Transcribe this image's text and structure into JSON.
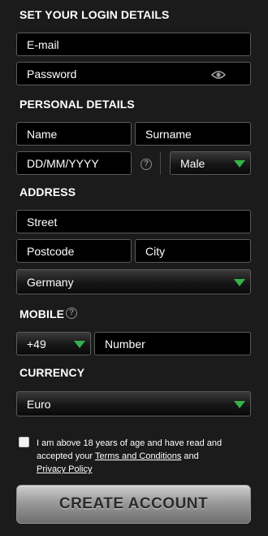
{
  "login": {
    "title": "SET YOUR LOGIN DETAILS",
    "email_placeholder": "E-mail",
    "password_placeholder": "Password"
  },
  "personal": {
    "title": "PERSONAL DETAILS",
    "name_placeholder": "Name",
    "surname_placeholder": "Surname",
    "dob_placeholder": "DD/MM/YYYY",
    "gender_value": "Male"
  },
  "address": {
    "title": "ADDRESS",
    "street_placeholder": "Street",
    "postcode_placeholder": "Postcode",
    "city_placeholder": "City",
    "country_value": "Germany"
  },
  "mobile": {
    "title": "MOBILE",
    "prefix_value": "+49",
    "number_placeholder": "Number"
  },
  "currency": {
    "title": "CURRENCY",
    "value": "Euro"
  },
  "terms": {
    "text_before": "I am above 18 years of age and have read and accepted your ",
    "terms_link": "Terms and Conditions",
    "text_middle": " and ",
    "privacy_link": "Privacy Policy"
  },
  "cta": {
    "label": "CREATE ACCOUNT"
  },
  "icons": {
    "help": "?",
    "password_toggle": "eye-icon",
    "dropdown": "chevron-down-icon"
  },
  "colors": {
    "accent": "#35b34a",
    "background": "#1b1b1b",
    "field": "#000000"
  }
}
